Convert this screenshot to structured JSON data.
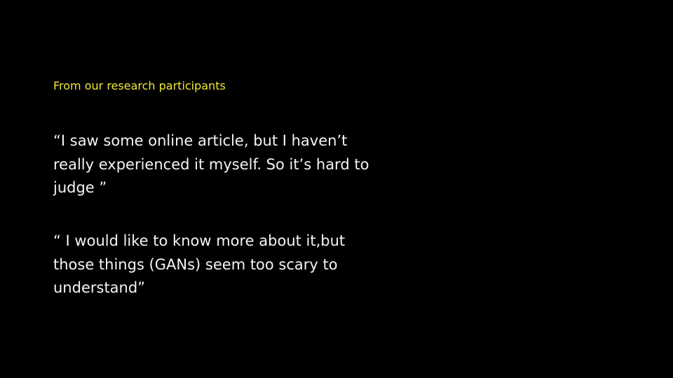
{
  "slide": {
    "eyebrow": "From our research participants",
    "quotes": [
      "“I saw some online article, but I haven’t really experienced it myself. So it’s hard to judge ”",
      "“ I would like to know more about it,but those things (GANs) seem too scary to understand”"
    ]
  },
  "colors": {
    "background": "#000000",
    "accent": "#f1e83a",
    "text": "#f4f4f4"
  }
}
